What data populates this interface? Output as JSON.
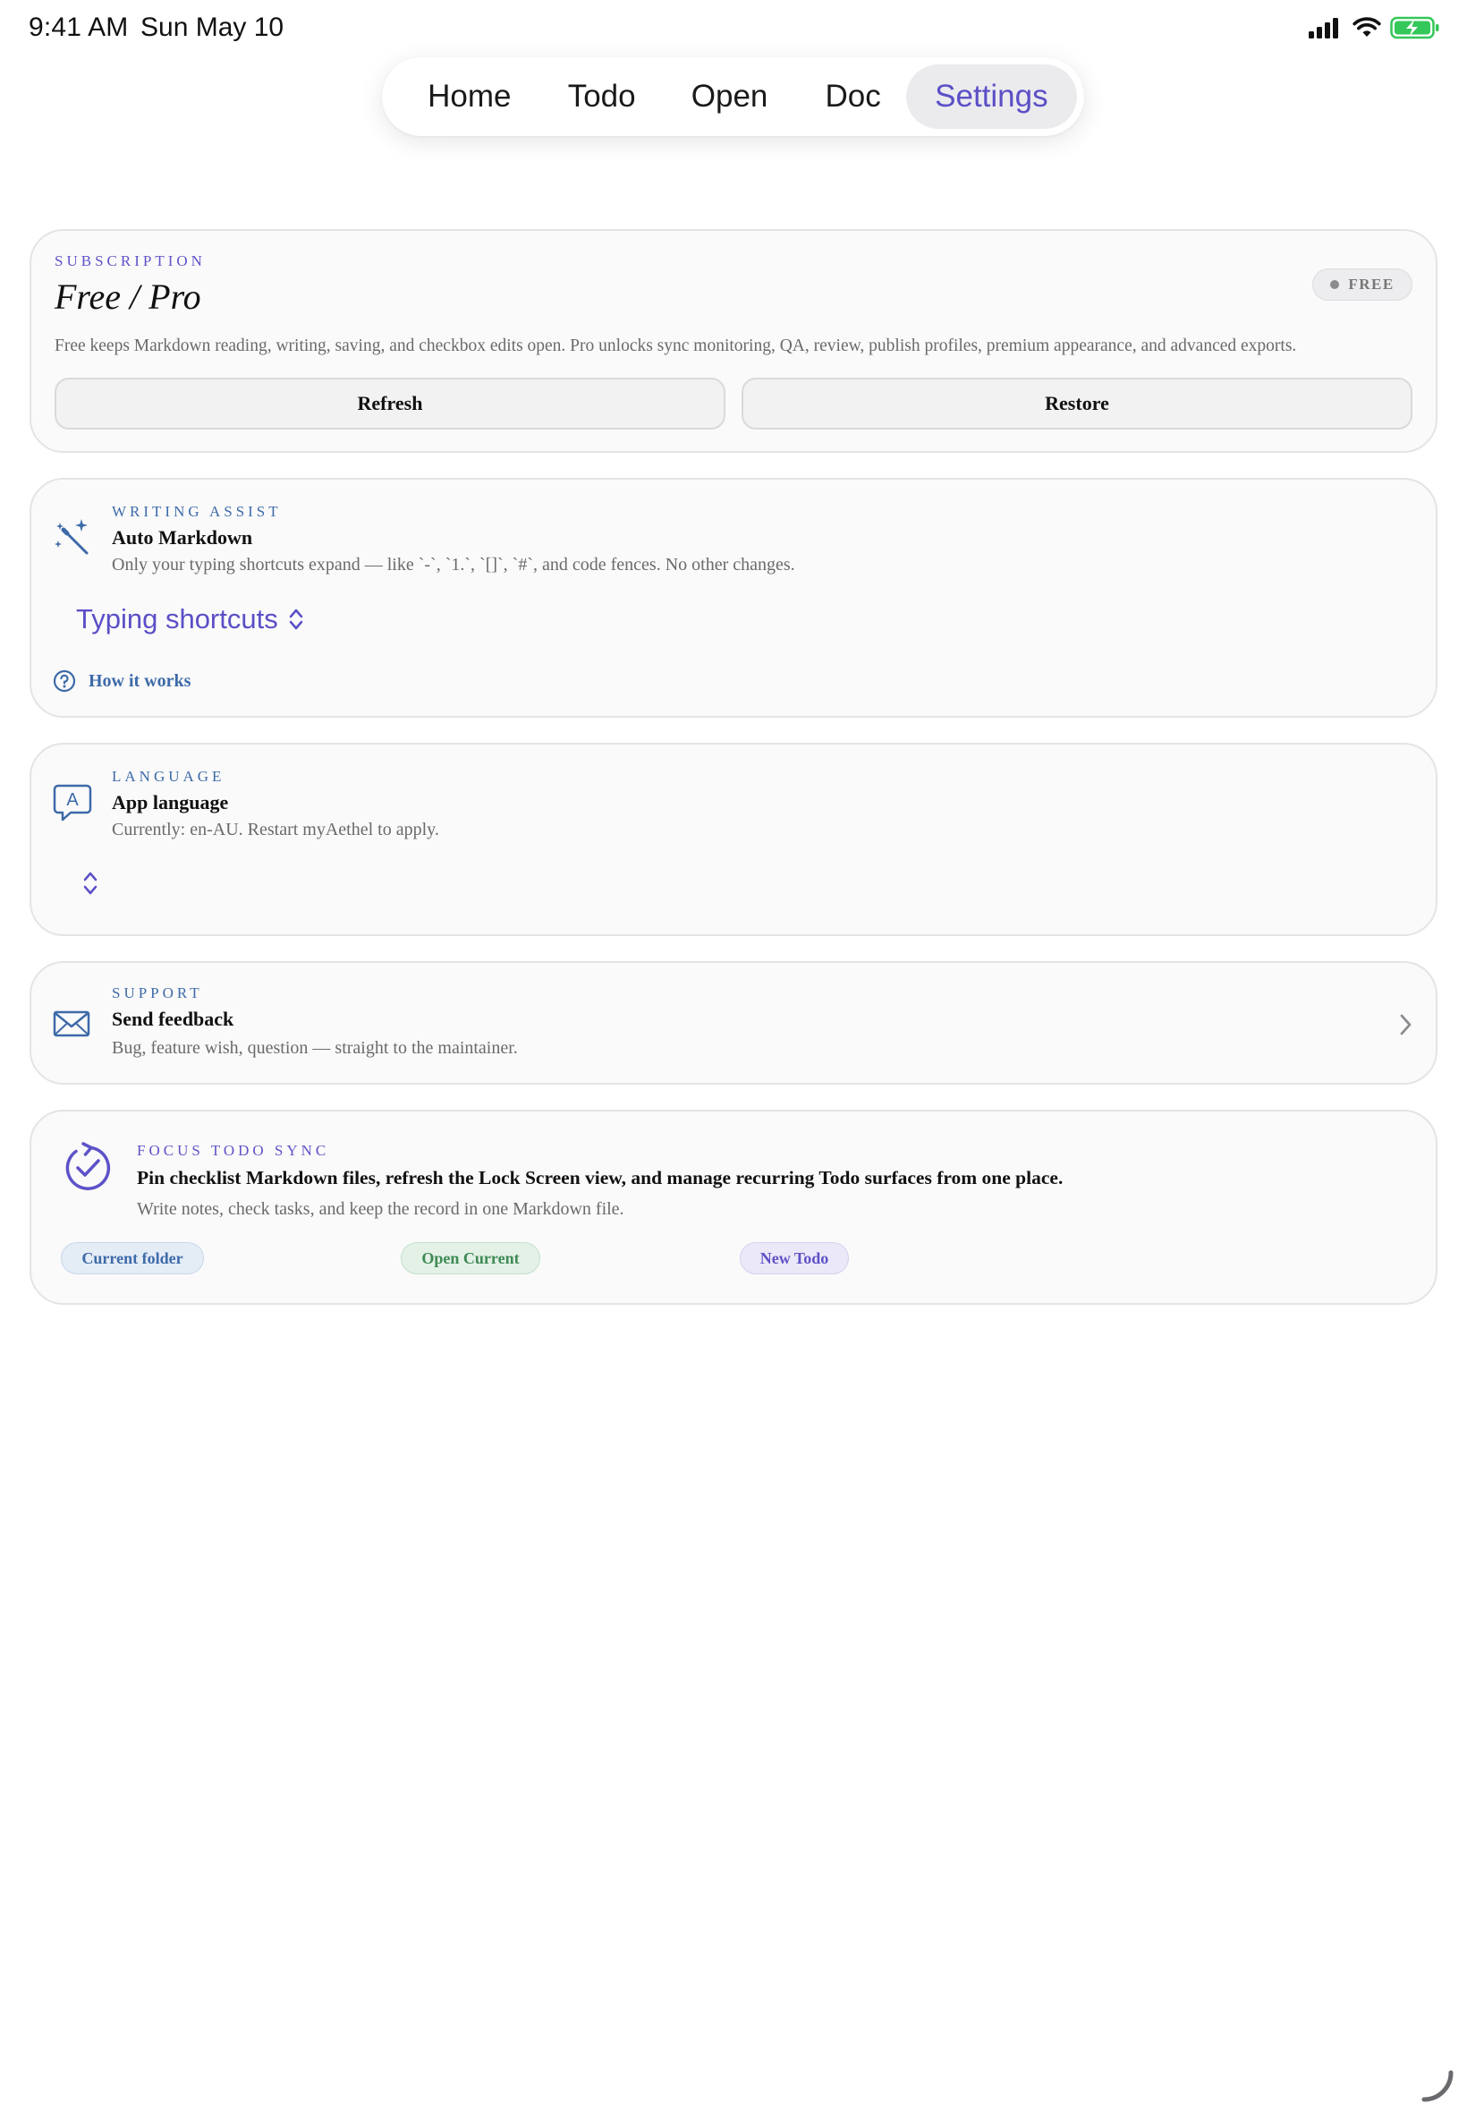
{
  "status_bar": {
    "time": "9:41 AM",
    "date": "Sun May 10",
    "icons": [
      "cellular-signal-icon",
      "wifi-icon",
      "battery-charging-icon"
    ]
  },
  "tabs": [
    {
      "label": "Home",
      "selected": false
    },
    {
      "label": "Todo",
      "selected": false
    },
    {
      "label": "Open",
      "selected": false
    },
    {
      "label": "Doc",
      "selected": false
    },
    {
      "label": "Settings",
      "selected": true
    }
  ],
  "subscription": {
    "eyebrow": "SUBSCRIPTION",
    "title": "Free / Pro",
    "badge": "FREE",
    "description": "Free keeps Markdown reading, writing, saving, and checkbox edits open. Pro unlocks sync monitoring, QA, review, publish profiles, premium appearance, and advanced exports.",
    "refresh_label": "Refresh",
    "restore_label": "Restore"
  },
  "writing_assist": {
    "eyebrow": "WRITING ASSIST",
    "title": "Auto Markdown",
    "description": "Only your typing shortcuts expand — like `-`, `1.`, `[]`, `#`, and code fences. No other changes.",
    "picker_value": "Typing shortcuts",
    "help_link": "How it works",
    "icon": "magic-wand-icon"
  },
  "language": {
    "eyebrow": "LANGUAGE",
    "title": "App language",
    "description": "Currently: en-AU. Restart myAethel to apply.",
    "picker_value": "",
    "icon": "language-bubble-icon"
  },
  "support": {
    "eyebrow": "SUPPORT",
    "title": "Send feedback",
    "description": "Bug, feature wish, question — straight to the maintainer.",
    "icon": "envelope-icon"
  },
  "focus_todo": {
    "eyebrow": "FOCUS TODO SYNC",
    "title": "Pin checklist Markdown files, refresh the Lock Screen view, and manage recurring Todo surfaces from one place.",
    "description": "Write notes, check tasks, and keep the record in one Markdown file.",
    "chips": [
      "Current folder",
      "Open Current",
      "New Todo"
    ],
    "icon": "sync-check-icon"
  },
  "colors": {
    "accent": "#5b4fc6",
    "link_blue": "#3d6aa8",
    "card_bg": "#fafafa",
    "card_border": "#e4e4e6",
    "battery_green": "#34c759"
  }
}
